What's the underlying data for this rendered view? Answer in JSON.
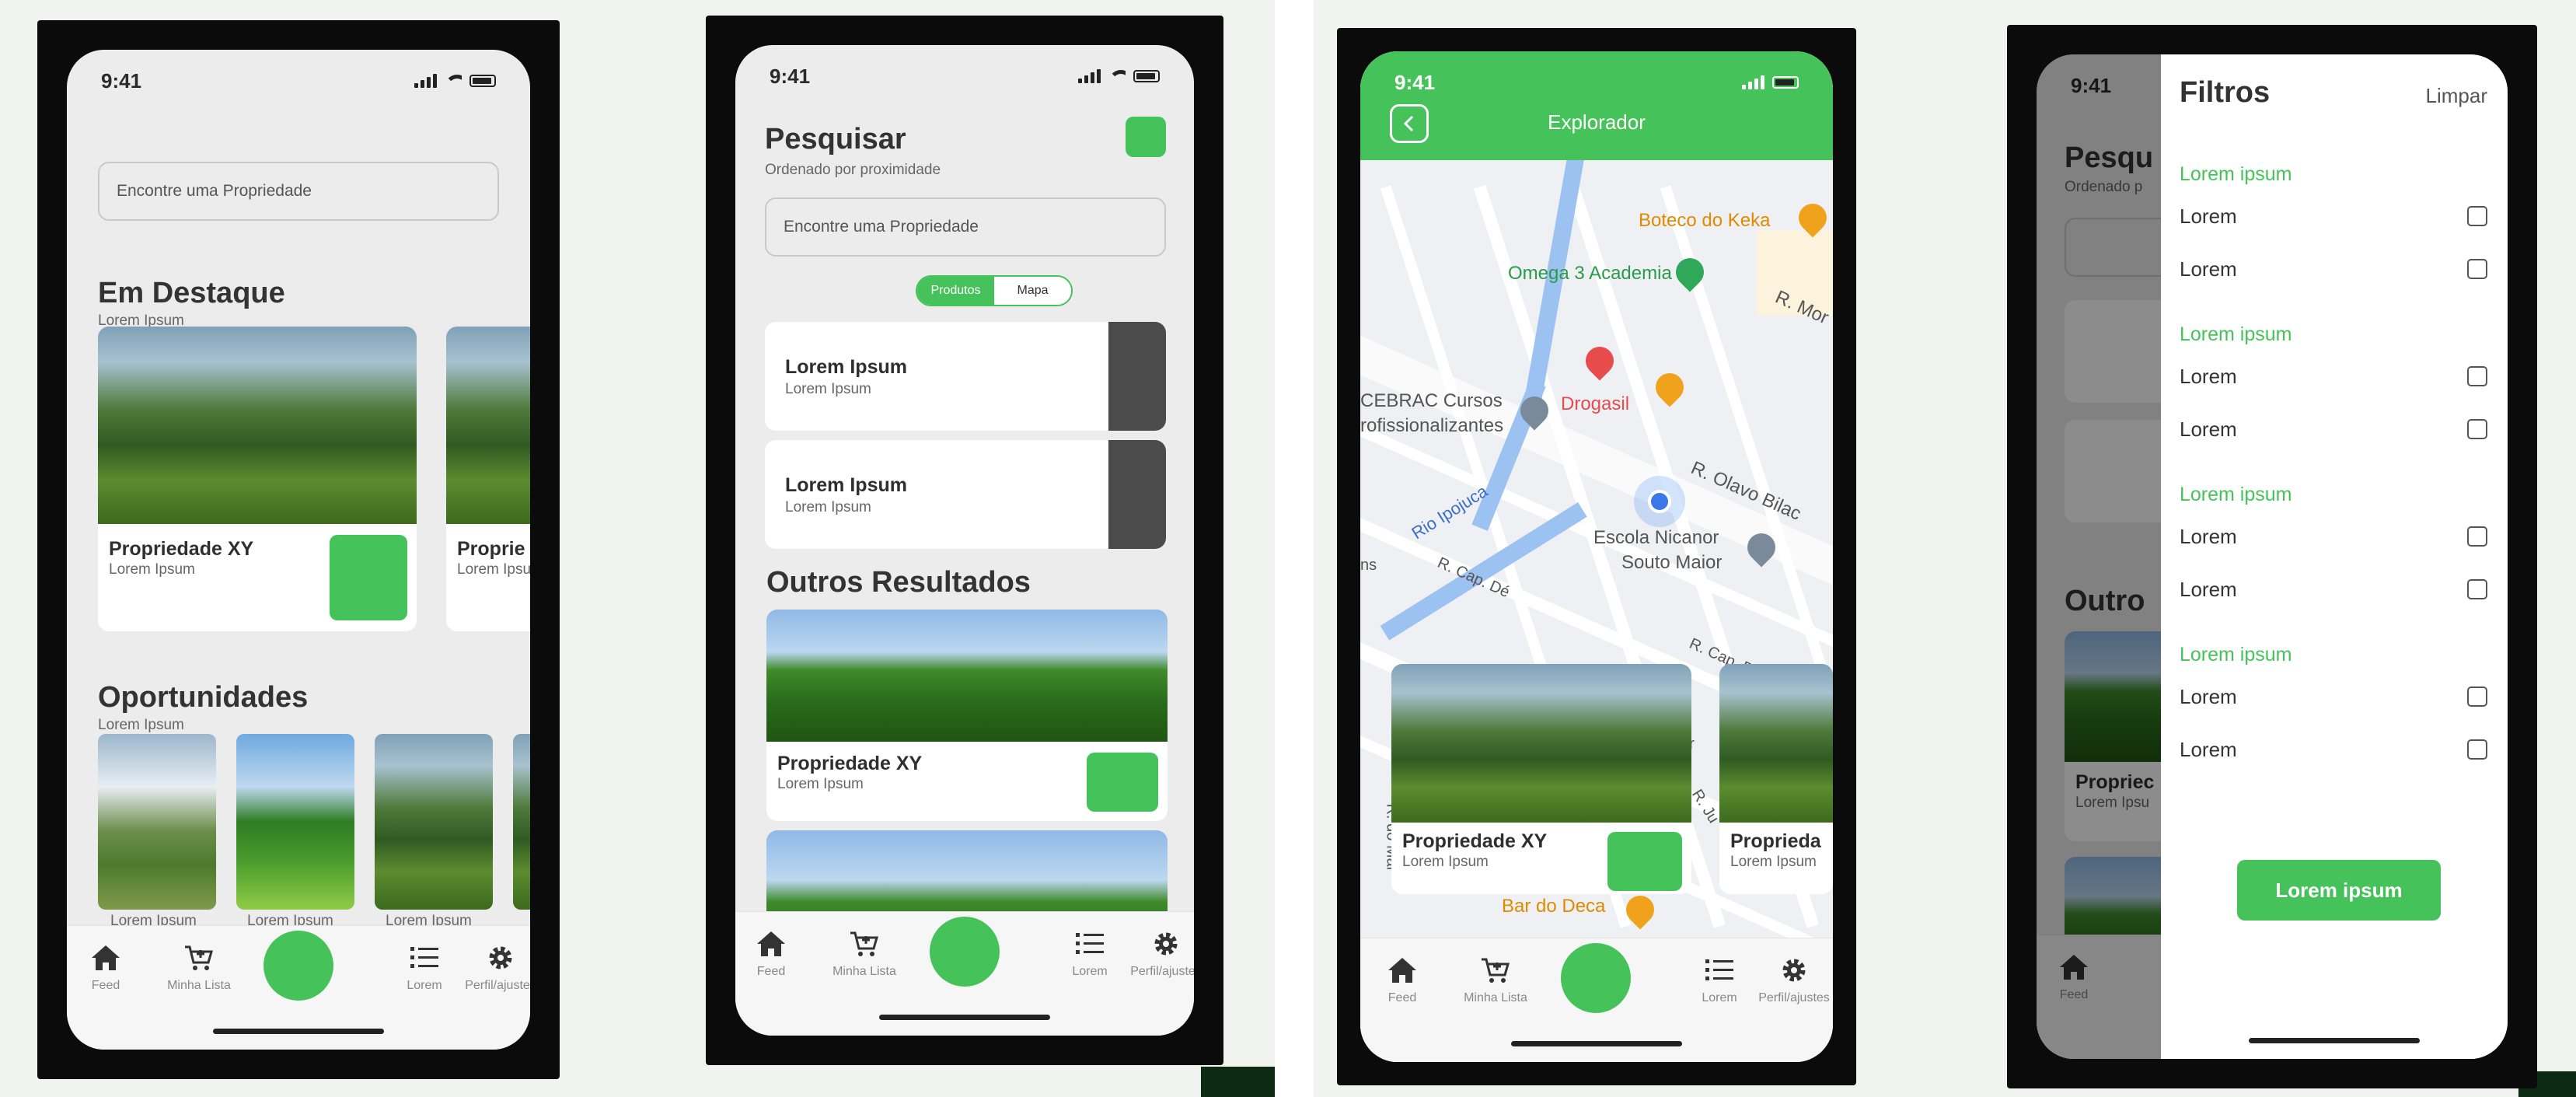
{
  "status": {
    "time": "9:41"
  },
  "nav": {
    "feed": "Feed",
    "list": "Minha Lista",
    "lorem": "Lorem",
    "settings": "Perfil/ajustes"
  },
  "screen1": {
    "search_placeholder": "Encontre uma Propriedade",
    "featured_title": "Em Destaque",
    "featured_sub": "Lorem Ipsum",
    "card_title": "Propriedade XY",
    "card_sub": "Lorem Ipsum",
    "card2_title": "Proprie",
    "card2_sub": "Lorem Ipsu",
    "opps_title": "Oportunidades",
    "opps_sub": "Lorem Ipsum",
    "opp_labels": [
      "Lorem Ipsum",
      "Lorem Ipsum",
      "Lorem Ipsum"
    ]
  },
  "screen2": {
    "title": "Pesquisar",
    "subtitle": "Ordenado por proximidade",
    "search_placeholder": "Encontre uma Propriedade",
    "seg_products": "Produtos",
    "seg_map": "Mapa",
    "results": [
      {
        "title": "Lorem Ipsum",
        "sub": "Lorem Ipsum"
      },
      {
        "title": "Lorem Ipsum",
        "sub": "Lorem Ipsum"
      }
    ],
    "others_title": "Outros Resultados",
    "card_title": "Propriedade XY",
    "card_sub": "Lorem Ipsum"
  },
  "screen3": {
    "header_title": "Explorador",
    "map_labels": {
      "boteco": "Boteco do Keka",
      "omega": "Omega 3 Academia",
      "rmor": "R. Mor",
      "cebrac1": "CEBRAC Cursos",
      "cebrac2": "rofissionalizantes",
      "drogasil": "Drogasil",
      "ipojuca": "Rio Ipojuca",
      "olavo": "R. Olavo Bilac",
      "escola1": "Escola Nicanor",
      "escola2": "Souto Maior",
      "capde1": "R. Cap. Dé",
      "capde2": "R. Cap. Dé",
      "ns": "ns",
      "teir": "teir",
      "rju": "R. Ju",
      "rdomar": "R. do Mar",
      "bardeca": "Bar do Deca"
    },
    "card_title": "Propriedade XY",
    "card_sub": "Lorem Ipsum",
    "card2_title": "Proprieda",
    "card2_sub": "Lorem Ipsum"
  },
  "screen4": {
    "bg_title": "Pesqu",
    "bg_sub": "Ordenado p",
    "bg_outros": "Outro",
    "bg_card": "Propriec",
    "bg_card_sub": "Lorem Ipsu",
    "bg_feed": "Feed",
    "filters_title": "Filtros",
    "clear": "Limpar",
    "sections": [
      {
        "label": "Lorem ipsum",
        "items": [
          "Lorem",
          "Lorem"
        ]
      },
      {
        "label": "Lorem ipsum",
        "items": [
          "Lorem",
          "Lorem"
        ]
      },
      {
        "label": "Lorem ipsum",
        "items": [
          "Lorem",
          "Lorem"
        ]
      },
      {
        "label": "Lorem ipsum",
        "items": [
          "Lorem",
          "Lorem"
        ]
      }
    ],
    "apply": "Lorem ipsum"
  },
  "colors": {
    "accent": "#45c35a",
    "frame": "#0b0b0b"
  }
}
